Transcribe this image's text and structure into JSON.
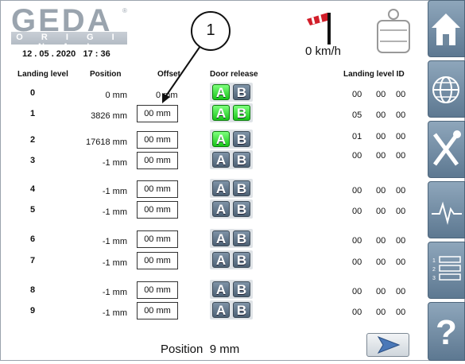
{
  "header": {
    "logo_text": "GEDA",
    "logo_subtext": "O R I G I N A L",
    "date": "12 . 05 . 2020",
    "time": "17 : 36",
    "wind_speed": "0 km/h"
  },
  "callout": {
    "number": "1"
  },
  "columns": {
    "landing_level": "Landing level",
    "position": "Position",
    "offset": "Offset",
    "door_release": "Door release",
    "landing_level_id": "Landing level ID"
  },
  "rows": [
    {
      "level": "0",
      "position": "0 mm",
      "offset": "0 mm",
      "a_on": true,
      "b_on": false,
      "id": [
        "00",
        "00",
        "00"
      ]
    },
    {
      "level": "1",
      "position": "3826 mm",
      "offset": "00 mm",
      "a_on": true,
      "b_on": true,
      "id": [
        "05",
        "00",
        "00"
      ]
    },
    {
      "level": "2",
      "position": "17618 mm",
      "offset": "00 mm",
      "a_on": true,
      "b_on": false,
      "id": [
        "01",
        "00",
        "00"
      ]
    },
    {
      "level": "3",
      "position": "-1 mm",
      "offset": "00 mm",
      "a_on": false,
      "b_on": false,
      "id": [
        "00",
        "00",
        "00"
      ]
    },
    {
      "level": "4",
      "position": "-1 mm",
      "offset": "00 mm",
      "a_on": false,
      "b_on": false,
      "id": [
        "00",
        "00",
        "00"
      ]
    },
    {
      "level": "5",
      "position": "-1 mm",
      "offset": "00 mm",
      "a_on": false,
      "b_on": false,
      "id": [
        "00",
        "00",
        "00"
      ]
    },
    {
      "level": "6",
      "position": "-1 mm",
      "offset": "00 mm",
      "a_on": false,
      "b_on": false,
      "id": [
        "00",
        "00",
        "00"
      ]
    },
    {
      "level": "7",
      "position": "-1 mm",
      "offset": "00 mm",
      "a_on": false,
      "b_on": false,
      "id": [
        "00",
        "00",
        "00"
      ]
    },
    {
      "level": "8",
      "position": "-1 mm",
      "offset": "00 mm",
      "a_on": false,
      "b_on": false,
      "id": [
        "00",
        "00",
        "00"
      ]
    },
    {
      "level": "9",
      "position": "-1 mm",
      "offset": "00 mm",
      "a_on": false,
      "b_on": false,
      "id": [
        "00",
        "00",
        "00"
      ]
    }
  ],
  "buttons": {
    "a_label": "A",
    "b_label": "B"
  },
  "footer": {
    "position_label": "Position",
    "position_value": "9 mm"
  },
  "sidebar": [
    {
      "icon": "home-icon"
    },
    {
      "icon": "globe-icon"
    },
    {
      "icon": "tools-icon"
    },
    {
      "icon": "signal-icon"
    },
    {
      "icon": "list-numbers-icon"
    },
    {
      "icon": "help-icon"
    }
  ],
  "colors": {
    "button_active": "#19c419",
    "button_inactive": "#4d6175",
    "sidebar": "#6f889e"
  }
}
